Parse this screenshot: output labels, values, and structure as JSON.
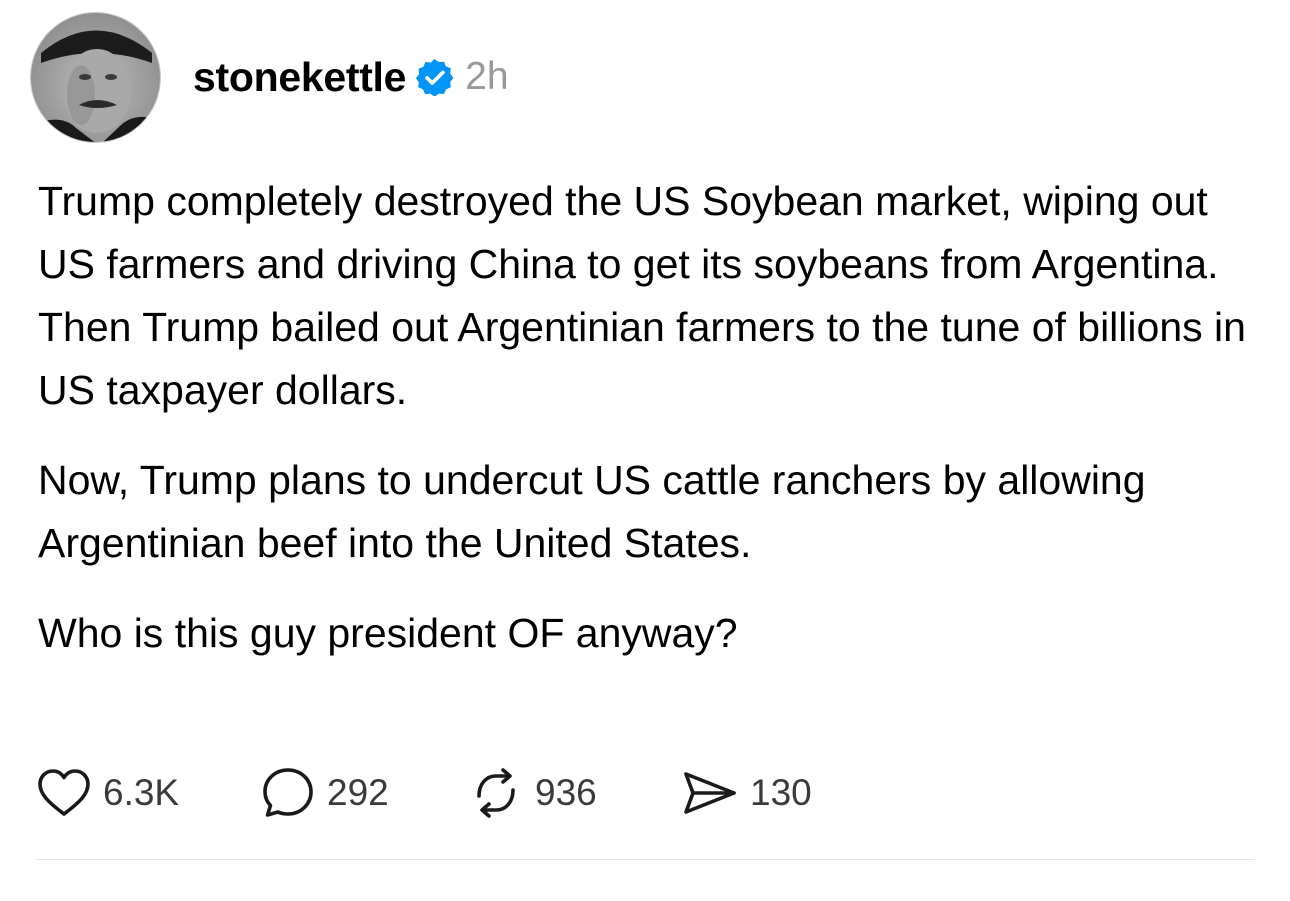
{
  "post": {
    "username": "stonekettle",
    "verified_icon": "verified-badge-icon",
    "timestamp": "2h",
    "paragraphs": [
      "Trump completely destroyed the US Soybean market, wiping out US farmers and driving China to get its soybeans from Argentina. Then Trump bailed out Argentinian farmers to the tune of billions in US taxpayer dollars.",
      "Now, Trump plans to undercut US cattle ranchers by allowing Argentinian beef into the United States.",
      "Who is this guy president OF anyway?"
    ],
    "actions": {
      "likes": "6.3K",
      "replies": "292",
      "reposts": "936",
      "shares": "130"
    }
  },
  "colors": {
    "verified": "#0095f6",
    "muted_text": "#999999",
    "divider": "#e3e3e3"
  }
}
